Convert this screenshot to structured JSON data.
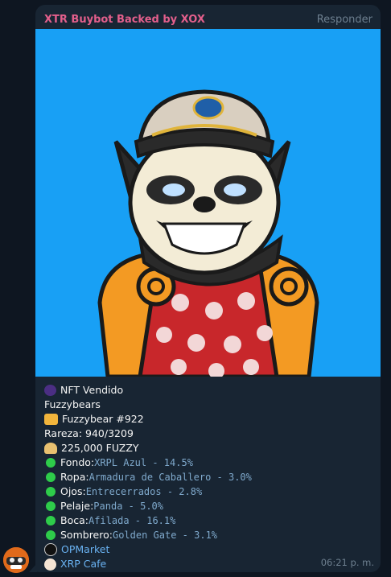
{
  "message": {
    "sender": "XTR Buybot Backed by XOX",
    "reply_label": "Responder",
    "time": "06:21 p. m."
  },
  "lines": {
    "sold": "NFT Vendido",
    "collection": "Fuzzybears",
    "item": "Fuzzybear #922",
    "rarity": "Rareza: 940/3209",
    "price": "225,000 FUZZY"
  },
  "traits": [
    {
      "label": "Fondo:",
      "value": "XRPL Azul - 14.5%"
    },
    {
      "label": "Ropa:",
      "value": "Armadura de Caballero - 3.0%"
    },
    {
      "label": "Ojos:",
      "value": "Entrecerrados - 2.8%"
    },
    {
      "label": "Pelaje:",
      "value": "Panda - 5.0%"
    },
    {
      "label": "Boca:",
      "value": "Afilada - 16.1%"
    },
    {
      "label": "Sombrero:",
      "value": "Golden Gate - 3.1%"
    }
  ],
  "links": {
    "market": "OPMarket",
    "cafe": "XRP Cafe"
  },
  "icons": {
    "nft": "nft-badge-icon",
    "item": "bear-emoji-icon",
    "price": "money-emoji-icon",
    "trait": "green-circle-icon",
    "market": "opmarket-logo-icon",
    "cafe": "xrpcafe-logo-icon"
  },
  "colors": {
    "background": "#0e1621",
    "bubble": "#182533",
    "sender": "#e35f8c",
    "link": "#6ab3f3",
    "image_bg": "#18a0f5"
  }
}
